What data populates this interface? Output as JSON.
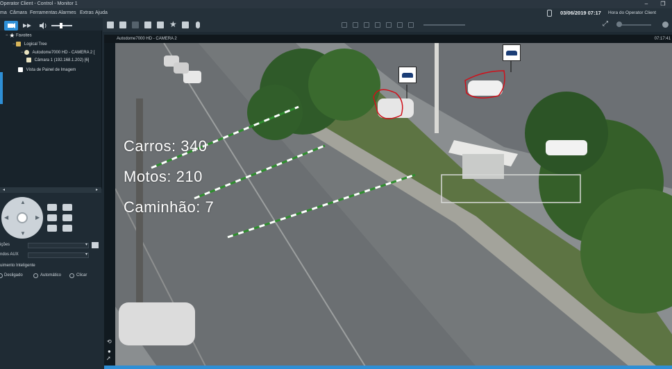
{
  "window": {
    "title": "Operator Client - Control - Monitor 1",
    "minimize": "–",
    "restore": "❐"
  },
  "menu": [
    "ma",
    "Câmara",
    "Ferramentas",
    "Alarmes",
    "Extras",
    "Ajuda"
  ],
  "status": {
    "datetime": "03/06/2019 07:17",
    "clock_label": "Hora do Operator Client"
  },
  "tree": {
    "favorites": "Favoites",
    "logical_tree": "Logical Tree",
    "camera_autodome": "Autodome7000 HD - CAMERA 2 [",
    "camera_1": "Câmara 1 (192.168.1.202) [6]",
    "image_panel_view": "Vista de Painel de Imagem"
  },
  "controls": {
    "positions_label": "ições",
    "aux_label": "ndos AUX",
    "intelligent_tracking_label": "uimento Inteligente",
    "radio_off": "Desligado",
    "radio_auto": "Automático",
    "radio_click": "Clicar"
  },
  "video": {
    "camera_title": "Autodome7000 HD - CAMERA 2",
    "timestamp": "07:17:41",
    "counts": {
      "cars": "Carros: 340",
      "motos": "Motos: 210",
      "trucks": "Caminhão: 7"
    }
  },
  "colors": {
    "accent": "#2e8fd6",
    "detection_outline": "#d0101a",
    "tripwire_green": "#2f8f2f",
    "tripwire_white": "#ffffff"
  }
}
